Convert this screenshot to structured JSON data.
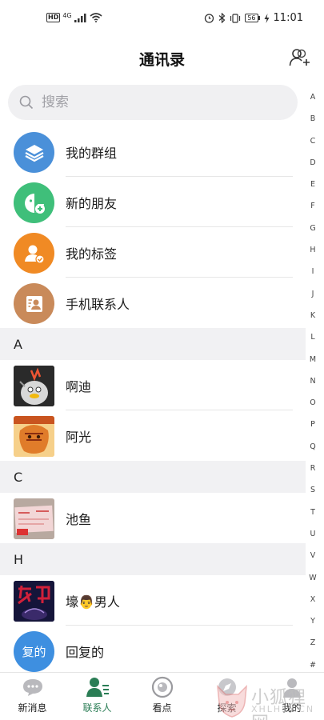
{
  "status_bar": {
    "hd": "HD",
    "signal": "4G",
    "battery": "56",
    "time": "11:01"
  },
  "header": {
    "title": "通讯录"
  },
  "search": {
    "placeholder": "搜索"
  },
  "quick_entries": [
    {
      "label": "我的群组",
      "icon": "layers-icon",
      "color": "#4a90d9"
    },
    {
      "label": "新的朋友",
      "icon": "new-friend-icon",
      "color": "#3fbf7a"
    },
    {
      "label": "我的标签",
      "icon": "tag-user-icon",
      "color": "#f08a24"
    },
    {
      "label": "手机联系人",
      "icon": "phone-contacts-icon",
      "color": "#c98a5a"
    }
  ],
  "sections": [
    {
      "letter": "A",
      "contacts": [
        {
          "name": "啊迪"
        },
        {
          "name": "阿光"
        }
      ]
    },
    {
      "letter": "C",
      "contacts": [
        {
          "name": "池鱼"
        }
      ]
    },
    {
      "letter": "H",
      "contacts": [
        {
          "name": "壕👨男人"
        },
        {
          "name": "回复的",
          "avatar_text": "复的"
        }
      ]
    }
  ],
  "alphabet": [
    "A",
    "B",
    "C",
    "D",
    "E",
    "F",
    "G",
    "H",
    "I",
    "J",
    "K",
    "L",
    "M",
    "N",
    "O",
    "P",
    "Q",
    "R",
    "S",
    "T",
    "U",
    "V",
    "W",
    "X",
    "Y",
    "Z",
    "#"
  ],
  "tabs": [
    {
      "label": "新消息",
      "icon": "chat-bubble-icon"
    },
    {
      "label": "联系人",
      "icon": "contacts-icon",
      "active": true
    },
    {
      "label": "看点",
      "icon": "eye-circle-icon"
    },
    {
      "label": "探索",
      "icon": "explore-icon"
    },
    {
      "label": "我的",
      "icon": "profile-icon"
    }
  ],
  "watermark": {
    "title": "小狐狸网",
    "sub": "XHLHSY.CN"
  },
  "colors": {
    "accent_green": "#2a7d55",
    "section_bg": "#f1f1f3",
    "blue_avatar": "#3e8fe0"
  }
}
